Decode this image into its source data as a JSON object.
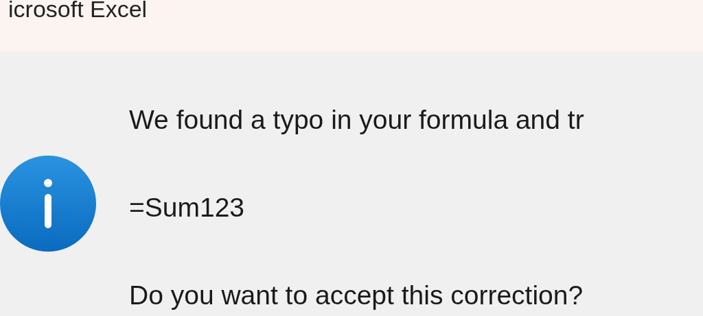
{
  "window": {
    "title": "icrosoft Excel"
  },
  "message": {
    "lines": [
      "We found a typo in your formula and tr",
      "=Sum123",
      "Do you want to accept this correction?"
    ]
  }
}
